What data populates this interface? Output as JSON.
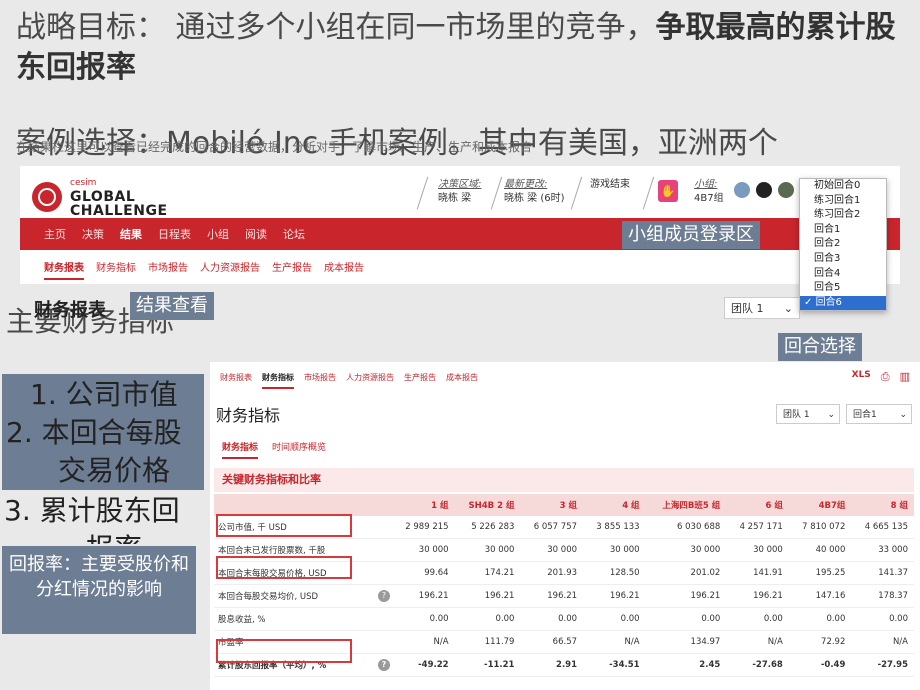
{
  "slide": {
    "title_normal": "战略目标： 通过多个小组在同一市场里的竞争，",
    "title_bold": "争取最高的累计股东回报率",
    "case_line": "案例选择：Mobilé Inc 手机案例。其中有美国，亚洲两个",
    "case_overlay": "在结果栏这里可以查看已经完成的回合的经营数据，分析对手，了解市场。生产、生产和成本报告",
    "main_heading": "主要财务指标"
  },
  "header": {
    "logo_small": "cesim",
    "logo_line1": "GLOBAL",
    "logo_line2": "CHALLENGE",
    "deadline_label": "决策区域:",
    "deadline_value": "晓栋 梁",
    "update_label": "最新更改:",
    "update_value": "晓栋 梁 (6时)",
    "status": "游戏结束",
    "group_label": "小组:",
    "group_value": "4B7组"
  },
  "nav": {
    "items": [
      "主页",
      "决策",
      "结果",
      "日程表",
      "小组",
      "阅读",
      "论坛"
    ],
    "active": "结果"
  },
  "subnav": {
    "items": [
      "财务报表",
      "财务指标",
      "市场报告",
      "人力资源报告",
      "生产报告",
      "成本报告"
    ],
    "active": "财务报表"
  },
  "labels": {
    "login_area": "小组成员登录区",
    "result_view": "结果查看",
    "round_select": "回合选择"
  },
  "page_title": "财务报表",
  "team_select": "团队 1",
  "dropdown": {
    "options": [
      "初始回合0",
      "练习回合1",
      "练习回合2",
      "回合1",
      "回合2",
      "回合3",
      "回合4",
      "回合5",
      "回合6"
    ],
    "selected": "回合6"
  },
  "left_panel": {
    "items": [
      "1. 公司市值",
      "2. 本回合每股",
      "交易价格",
      "3. 累计股东回",
      "报率"
    ],
    "note": "回报率：主要受股价和分红情况的影响"
  },
  "lower": {
    "tabs": [
      "财务报表",
      "财务指标",
      "市场报告",
      "人力资源报告",
      "生产报告",
      "成本报告"
    ],
    "active_tab": "财务指标",
    "icons": [
      "XLS",
      "print-icon",
      "chart-icon"
    ],
    "title": "财务指标",
    "team_select": "团队 1",
    "round_select": "回合1",
    "subtabs": [
      "财务指标",
      "时间顺序概览"
    ],
    "active_subtab": "财务指标",
    "section": "关键财务指标和比率",
    "table": {
      "columns": [
        "1 组",
        "SH4B 2 组",
        "3 组",
        "4 组",
        "上海四B班5 组",
        "6 组",
        "4B7组",
        "8 组"
      ],
      "rows": [
        {
          "name": "公司市值, 千 USD",
          "help": false,
          "bold": false,
          "values": [
            "2 989 215",
            "5 226 283",
            "6 057 757",
            "3 855 133",
            "6 030 688",
            "4 257 171",
            "7 810 072",
            "4 665 135"
          ]
        },
        {
          "name": "本回合末已发行股票数, 千股",
          "help": false,
          "bold": false,
          "values": [
            "30 000",
            "30 000",
            "30 000",
            "30 000",
            "30 000",
            "30 000",
            "40 000",
            "33 000"
          ]
        },
        {
          "name": "本回合末每股交易价格, USD",
          "help": false,
          "bold": false,
          "values": [
            "99.64",
            "174.21",
            "201.93",
            "128.50",
            "201.02",
            "141.91",
            "195.25",
            "141.37"
          ]
        },
        {
          "name": "本回合每股交易均价, USD",
          "help": true,
          "bold": false,
          "values": [
            "196.21",
            "196.21",
            "196.21",
            "196.21",
            "196.21",
            "196.21",
            "147.16",
            "178.37"
          ]
        },
        {
          "name": "股息收益, %",
          "help": false,
          "bold": false,
          "values": [
            "0.00",
            "0.00",
            "0.00",
            "0.00",
            "0.00",
            "0.00",
            "0.00",
            "0.00"
          ]
        },
        {
          "name": "市盈率",
          "help": false,
          "bold": false,
          "values": [
            "N/A",
            "111.79",
            "66.57",
            "N/A",
            "134.97",
            "N/A",
            "72.92",
            "N/A"
          ]
        },
        {
          "name": "累计股东回报率（平均）, %",
          "help": true,
          "bold": true,
          "values": [
            "-49.22",
            "-11.21",
            "2.91",
            "-34.51",
            "2.45",
            "-27.68",
            "-0.49",
            "-27.95"
          ]
        }
      ]
    }
  }
}
